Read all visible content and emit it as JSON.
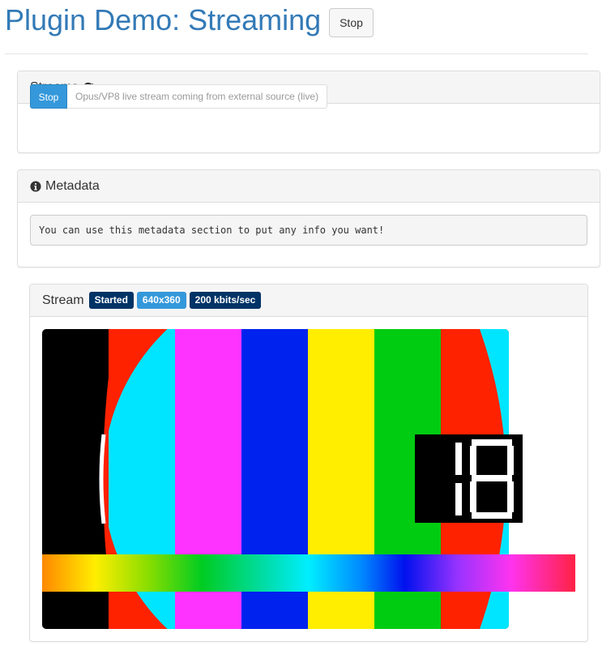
{
  "header": {
    "title": "Plugin Demo: Streaming",
    "stop_label": "Stop"
  },
  "streams_panel": {
    "title": "Streams",
    "refresh_icon": "refresh-icon",
    "stop_label": "Stop",
    "selected_stream": "Opus/VP8 live stream coming from external source (live)"
  },
  "metadata_panel": {
    "title": "Metadata",
    "info_icon": "info-circle-icon",
    "text": "You can use this metadata section to put any info you want!"
  },
  "stream_panel": {
    "title": "Stream",
    "badges": {
      "status": "Started",
      "resolution": "640x360",
      "bitrate": "200 kbits/sec"
    }
  },
  "video": {
    "digits_shown": "18",
    "bar_colors": [
      "#000000",
      "#ff2200",
      "#00e5ff",
      "#ff33ff",
      "#0022ee",
      "#ffee00",
      "#00cc11",
      "#ff2200",
      "#00e5ff"
    ]
  },
  "colors": {
    "accent": "#337ab7",
    "primary_button": "#3498db",
    "badge_dark": "#003366"
  }
}
